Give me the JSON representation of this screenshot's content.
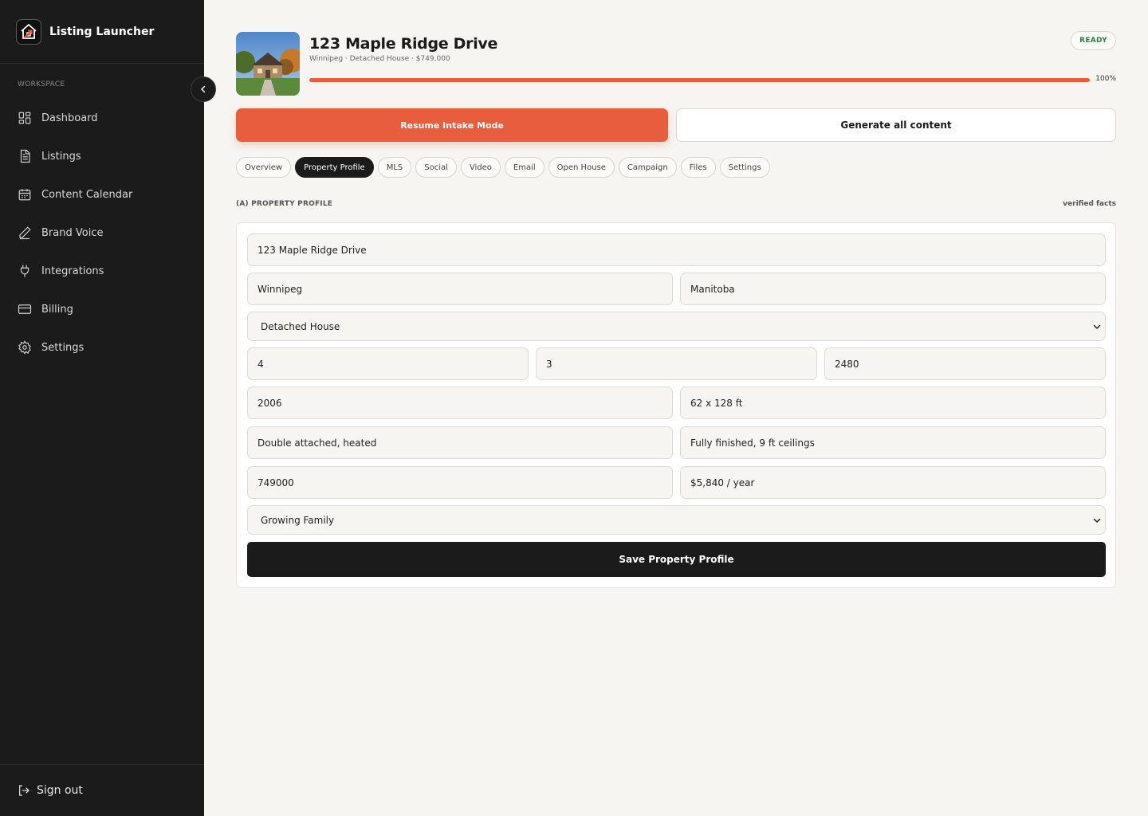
{
  "app": {
    "name": "Listing Launcher"
  },
  "sidebar": {
    "section_label": "WORKSPACE",
    "items": [
      {
        "label": "Dashboard",
        "icon": "dashboard-icon"
      },
      {
        "label": "Listings",
        "icon": "document-icon"
      },
      {
        "label": "Content Calendar",
        "icon": "calendar-icon"
      },
      {
        "label": "Brand Voice",
        "icon": "pen-icon"
      },
      {
        "label": "Integrations",
        "icon": "plug-icon"
      },
      {
        "label": "Billing",
        "icon": "credit-card-icon"
      },
      {
        "label": "Settings",
        "icon": "gear-icon"
      }
    ],
    "signout_label": "Sign out"
  },
  "listing": {
    "title": "123 Maple Ridge Drive",
    "subtitle": "Winnipeg · Detached House · $749,000",
    "status": "READY",
    "progress_percent": 100,
    "progress_label": "100%"
  },
  "actions": {
    "resume_label": "Resume Intake Mode",
    "generate_label": "Generate all content"
  },
  "tabs": [
    "Overview",
    "Property Profile",
    "MLS",
    "Social",
    "Video",
    "Email",
    "Open House",
    "Campaign",
    "Files",
    "Settings"
  ],
  "active_tab": "Property Profile",
  "profile": {
    "section_title": "(A) PROPERTY PROFILE",
    "section_note": "verified facts",
    "address": "123 Maple Ridge Drive",
    "city": "Winnipeg",
    "province": "Manitoba",
    "property_type": "Detached House",
    "bedrooms": "4",
    "bathrooms": "3",
    "square_feet": "2480",
    "year_built": "2006",
    "lot_size": "62 x 128 ft",
    "garage": "Double attached, heated",
    "basement": "Fully finished, 9 ft ceilings",
    "price": "749000",
    "taxes": "$5,840 / year",
    "target_buyer": "Growing Family",
    "save_label": "Save Property Profile"
  },
  "colors": {
    "accent": "#e85d3d",
    "sidebar_bg": "#1b1b1b",
    "ready_green": "#2f7d43",
    "page_bg": "#f6f5f2"
  }
}
